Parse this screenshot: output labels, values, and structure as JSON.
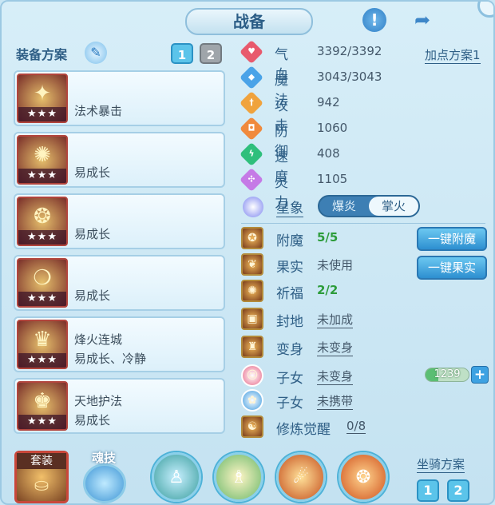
{
  "title": "战备",
  "icons": {
    "alert": "exclamation-icon",
    "share": "share-icon"
  },
  "left": {
    "scheme_label": "装备方案",
    "tabs": [
      "1",
      "2"
    ],
    "equipment": [
      {
        "icon": "popsicle-weapon-icon",
        "glyph": "✦",
        "stars": "★★★",
        "line1": "",
        "line2": "法术暴击"
      },
      {
        "icon": "armor-icon",
        "glyph": "✺",
        "stars": "★★★",
        "line1": "",
        "line2": "易成长"
      },
      {
        "icon": "necklace-icon",
        "glyph": "❂",
        "stars": "★★★",
        "line1": "",
        "line2": "易成长"
      },
      {
        "icon": "chain-belt-icon",
        "glyph": "❍",
        "stars": "★★★",
        "line1": "",
        "line2": "易成长"
      },
      {
        "icon": "helmet-icon",
        "glyph": "♛",
        "stars": "★★★",
        "line1": "烽火连城",
        "line2": "易成长、冷静"
      },
      {
        "icon": "robe-icon",
        "glyph": "♚",
        "stars": "★★★",
        "line1": "天地护法",
        "line2": "易成长"
      }
    ]
  },
  "stats": {
    "plan_link": "加点方案1",
    "rows": [
      {
        "name": "气血",
        "value": "3392/3392",
        "color": "#e85a6d",
        "glyph": "♥"
      },
      {
        "name": "魔法",
        "value": "3043/3043",
        "color": "#4aa3e8",
        "glyph": "◆"
      },
      {
        "name": "攻击",
        "value": "942",
        "color": "#f0a33d",
        "glyph": "†"
      },
      {
        "name": "防御",
        "value": "1060",
        "color": "#f08a3d",
        "glyph": "◘"
      },
      {
        "name": "速度",
        "value": "408",
        "color": "#2fbf7c",
        "glyph": "ϟ"
      },
      {
        "name": "灵力",
        "value": "1105",
        "color": "#c57ae6",
        "glyph": "✣"
      }
    ],
    "star_sign": {
      "label": "星象",
      "options": [
        "爆炎",
        "掌火"
      ],
      "selected": "掌火"
    }
  },
  "buffs": [
    {
      "icon": "enchant-icon",
      "glyph": "✪",
      "name": "附魔",
      "value": "5/5",
      "style": "green"
    },
    {
      "icon": "fruit-icon",
      "glyph": "❦",
      "name": "果实",
      "value": "未使用",
      "style": "plain"
    },
    {
      "icon": "blessing-icon",
      "glyph": "✺",
      "name": "祈福",
      "value": "2/2",
      "style": "green"
    },
    {
      "icon": "seal-land-icon",
      "glyph": "▣",
      "name": "封地",
      "value": "未加成",
      "style": "ul"
    },
    {
      "icon": "transform-icon",
      "glyph": "♜",
      "name": "变身",
      "value": "未变身",
      "style": "ul"
    },
    {
      "icon": "child-icon",
      "glyph": "☺",
      "name": "子女",
      "value": "未变身",
      "style": "ul"
    },
    {
      "icon": "pawprint-icon",
      "glyph": "✿",
      "name": "子女",
      "value": "未携带",
      "style": "ul"
    },
    {
      "icon": "cultivation-icon",
      "glyph": "☯",
      "name": "修炼觉醒",
      "value": "0/8",
      "style": "ul"
    }
  ],
  "actions": {
    "enchant_btn": "一键附魔",
    "fruit_btn": "一键果实"
  },
  "meter": {
    "value": "1239",
    "plus": "+"
  },
  "bottom": {
    "set_label": "套装",
    "skill_label": "魂技",
    "mount_label": "坐骑方案",
    "mount_tabs": [
      "1",
      "2"
    ]
  }
}
